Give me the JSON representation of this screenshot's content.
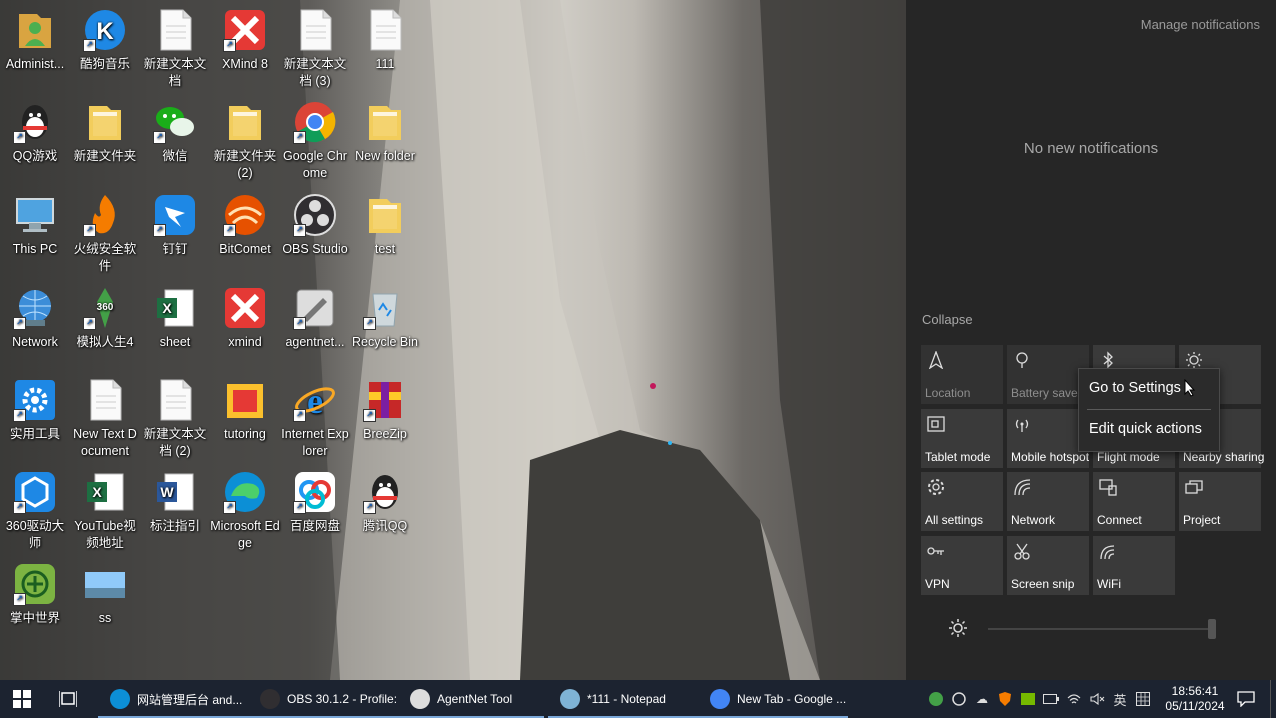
{
  "desktop": {
    "icons": [
      {
        "label": "Administ...",
        "icon": "user-folder-icon",
        "color": "#d9a441"
      },
      {
        "label": "酷狗音乐",
        "icon": "kugou-icon",
        "color": "#1e88e5"
      },
      {
        "label": "新建文本文档",
        "icon": "text-document-icon",
        "color": "#eeeeee"
      },
      {
        "label": "XMind 8",
        "icon": "xmind-icon",
        "color": "#e53935"
      },
      {
        "label": "新建文本文档 (3)",
        "icon": "text-document-icon",
        "color": "#eeeeee"
      },
      {
        "label": "111",
        "icon": "text-document-icon",
        "color": "#eeeeee"
      },
      {
        "label": "QQ游戏",
        "icon": "qq-game-icon",
        "color": "#222222"
      },
      {
        "label": "新建文件夹",
        "icon": "folder-icon",
        "color": "#f2cd5c"
      },
      {
        "label": "微信",
        "icon": "wechat-icon",
        "color": "#1aad19"
      },
      {
        "label": "新建文件夹 (2)",
        "icon": "folder-icon",
        "color": "#f2cd5c"
      },
      {
        "label": "Google Chrome",
        "icon": "chrome-icon",
        "color": "#4285f4"
      },
      {
        "label": "New folder",
        "icon": "folder-icon",
        "color": "#f2cd5c"
      },
      {
        "label": "This PC",
        "icon": "computer-icon",
        "color": "#4fa3e0"
      },
      {
        "label": "火绒安全软件",
        "icon": "huorong-icon",
        "color": "#f57c00"
      },
      {
        "label": "钉钉",
        "icon": "dingtalk-icon",
        "color": "#1e88e5"
      },
      {
        "label": "BitComet",
        "icon": "bitcomet-icon",
        "color": "#e65100"
      },
      {
        "label": "OBS Studio",
        "icon": "obs-icon",
        "color": "#302e31"
      },
      {
        "label": "test",
        "icon": "folder-icon",
        "color": "#f2cd5c"
      },
      {
        "label": "Network",
        "icon": "network-globe-icon",
        "color": "#3c8dd8"
      },
      {
        "label": "模拟人生4",
        "icon": "sims-icon",
        "color": "#43a047"
      },
      {
        "label": "sheet",
        "icon": "excel-icon",
        "color": "#1d6f42"
      },
      {
        "label": "xmind",
        "icon": "xmind-icon",
        "color": "#e53935"
      },
      {
        "label": "agentnet...",
        "icon": "agentnet-icon",
        "color": "#dddddd"
      },
      {
        "label": "Recycle Bin",
        "icon": "recycle-bin-icon",
        "color": "#cfd8dc"
      },
      {
        "label": "实用工具",
        "icon": "gear-tool-icon",
        "color": "#1e88e5"
      },
      {
        "label": "New Text Document",
        "icon": "text-document-icon",
        "color": "#eeeeee"
      },
      {
        "label": "新建文本文档 (2)",
        "icon": "text-document-icon",
        "color": "#eeeeee"
      },
      {
        "label": "tutoring",
        "icon": "tutoring-icon",
        "color": "#e53935"
      },
      {
        "label": "Internet Explorer",
        "icon": "ie-icon",
        "color": "#1e88e5"
      },
      {
        "label": "BreeZip",
        "icon": "breezip-icon",
        "color": "#c62828"
      },
      {
        "label": "360驱动大师",
        "icon": "driver-icon",
        "color": "#1e88e5"
      },
      {
        "label": "YouTube视频地址",
        "icon": "excel-icon",
        "color": "#1d6f42"
      },
      {
        "label": "标注指引",
        "icon": "word-icon",
        "color": "#2b579a"
      },
      {
        "label": "Microsoft Edge",
        "icon": "edge-icon",
        "color": "#0c8fd6"
      },
      {
        "label": "百度网盘",
        "icon": "baidu-netdisk-icon",
        "color": "#2196f3"
      },
      {
        "label": "腾讯QQ",
        "icon": "qq-icon",
        "color": "#222222"
      },
      {
        "label": "掌中世界",
        "icon": "zhangzhong-icon",
        "color": "#7cb342"
      },
      {
        "label": "ss",
        "icon": "image-thumbnail-icon",
        "color": "#90caf9"
      }
    ]
  },
  "action_center": {
    "manage_label": "Manage notifications",
    "empty_label": "No new notifications",
    "collapse_label": "Collapse",
    "tiles": [
      {
        "label": "Location",
        "icon": "location-icon",
        "active": false
      },
      {
        "label": "Battery saver",
        "icon": "battery-saver-icon",
        "active": false
      },
      {
        "label": "",
        "icon": "bluetooth-icon",
        "active": true
      },
      {
        "label": "ght",
        "icon": "night-light-icon",
        "active": true
      },
      {
        "label": "Tablet mode",
        "icon": "tablet-mode-icon",
        "active": true
      },
      {
        "label": "Mobile hotspot",
        "icon": "hotspot-icon",
        "active": true
      },
      {
        "label": "Flight mode",
        "icon": "airplane-icon",
        "active": true
      },
      {
        "label": "Nearby sharing",
        "icon": "nearby-sharing-icon",
        "active": true
      },
      {
        "label": "All settings",
        "icon": "settings-gear-icon",
        "active": true
      },
      {
        "label": "Network",
        "icon": "network-icon",
        "active": true
      },
      {
        "label": "Connect",
        "icon": "connect-icon",
        "active": true
      },
      {
        "label": "Project",
        "icon": "project-icon",
        "active": true
      },
      {
        "label": "VPN",
        "icon": "vpn-icon",
        "active": true
      },
      {
        "label": "Screen snip",
        "icon": "screen-snip-icon",
        "active": true
      },
      {
        "label": "WiFi",
        "icon": "wifi-icon",
        "active": true
      }
    ],
    "context_menu": {
      "go_settings": "Go to Settings",
      "edit_quick": "Edit quick actions"
    },
    "brightness_level": 1.0
  },
  "taskbar": {
    "buttons": [
      {
        "label": "网站管理后台 and...",
        "icon": "edge-icon",
        "color": "#0c8fd6"
      },
      {
        "label": "OBS 30.1.2 - Profile:...",
        "icon": "obs-icon",
        "color": "#302e31"
      },
      {
        "label": "AgentNet Tool",
        "icon": "agentnet-icon",
        "color": "#dddddd"
      },
      {
        "label": "*111 - Notepad",
        "icon": "notepad-icon",
        "color": "#7fb3d5"
      },
      {
        "label": "New Tab - Google ...",
        "icon": "chrome-icon",
        "color": "#4285f4"
      }
    ],
    "tray": {
      "ime_label": "英",
      "time": "18:56:41",
      "date": "05/11/2024"
    }
  },
  "colors": {
    "accent": "#7aa7d8",
    "taskbar_bg": "#1c2330",
    "panel_bg": "#262626"
  }
}
